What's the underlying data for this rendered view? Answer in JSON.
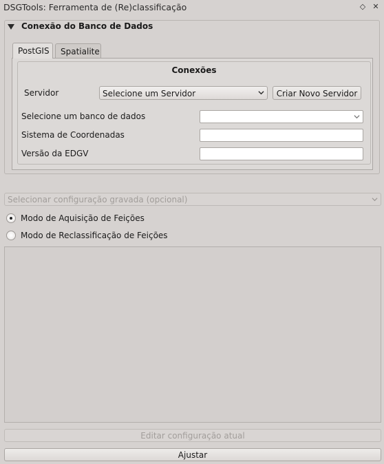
{
  "window": {
    "title": "DSGTools: Ferramenta de (Re)classificação",
    "float_glyph": "◇",
    "close_glyph": "✕"
  },
  "connection_group": {
    "title": "Conexão do Banco de Dados",
    "tabs": [
      {
        "label": "PostGIS",
        "active": true
      },
      {
        "label": "Spatialite",
        "active": false
      }
    ],
    "connections_title": "Conexões",
    "server_label": "Servidor",
    "server_selected": "Selecione um Servidor",
    "new_server_label": "Criar Novo Servidor",
    "database_label": "Selecione um banco de dados",
    "database_selected": "",
    "crs_label": "Sistema de Coordenadas",
    "crs_value": "",
    "edgv_label": "Versão da EDGV",
    "edgv_value": ""
  },
  "saved_config": {
    "placeholder": "Selecionar configuração gravada (opcional)"
  },
  "modes": [
    {
      "label": "Modo de Aquisição de Feições",
      "checked": true
    },
    {
      "label": "Modo de Reclassificação de Feições",
      "checked": false
    }
  ],
  "buttons": {
    "edit_config": "Editar configuração atual",
    "adjust": "Ajustar"
  },
  "icons": {
    "group_toggle": "triangle-down-icon",
    "combo_arrow": "chevron-down-icon",
    "float": "diamond-icon",
    "close": "close-icon"
  }
}
